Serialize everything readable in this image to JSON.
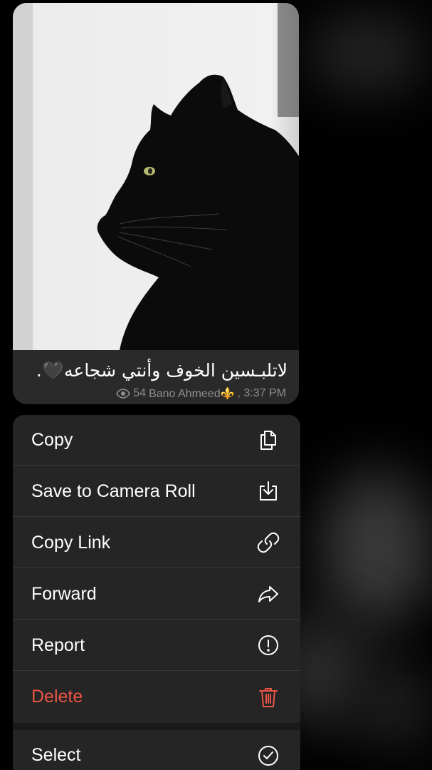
{
  "message": {
    "caption": "لاتلبـسين الخوف وأنتي شجاعه🖤.",
    "views": "54",
    "author": "Bano Ahmeed⚜️",
    "time": ", 3:37 PM"
  },
  "menu": {
    "items": [
      {
        "label": "Copy",
        "icon": "copy-icon"
      },
      {
        "label": "Save to Camera Roll",
        "icon": "save-download-icon"
      },
      {
        "label": "Copy Link",
        "icon": "link-icon"
      },
      {
        "label": "Forward",
        "icon": "forward-arrow-icon"
      },
      {
        "label": "Report",
        "icon": "report-exclamation-icon"
      },
      {
        "label": "Delete",
        "icon": "trash-icon"
      },
      {
        "label": "Select",
        "icon": "checkmark-circle-icon"
      }
    ]
  },
  "colors": {
    "menu_bg": "#252526",
    "danger": "#eb5545",
    "meta_text": "#8e8e93"
  }
}
